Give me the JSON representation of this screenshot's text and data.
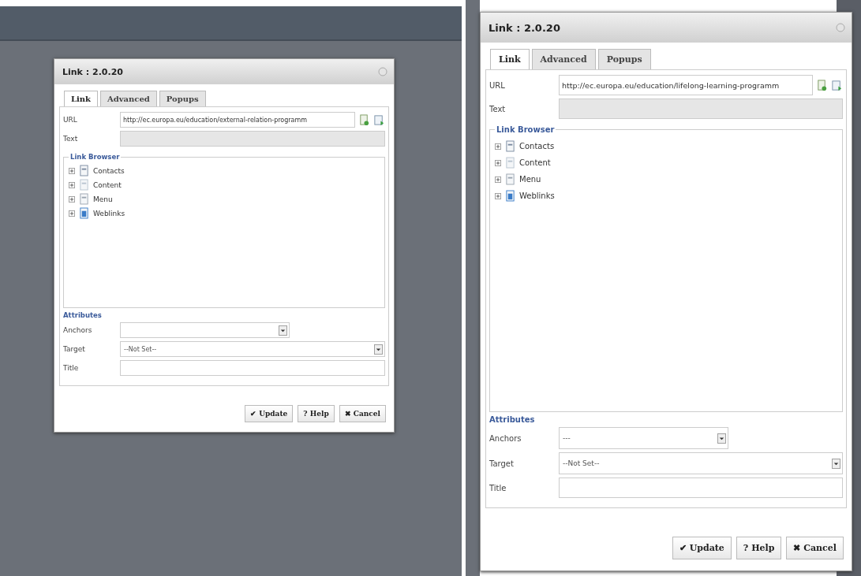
{
  "screenshots": [
    {
      "dialog": {
        "title": "Link : 2.0.20",
        "tabs": [
          {
            "label": "Link",
            "selected": true
          },
          {
            "label": "Advanced",
            "selected": false
          },
          {
            "label": "Popups",
            "selected": false
          }
        ],
        "url": {
          "label": "URL",
          "value": "http://ec.europa.eu/education/external-relation-programm"
        },
        "text": {
          "label": "Text",
          "disabled": true
        },
        "link_browser": {
          "legend": "Link Browser",
          "items": [
            {
              "label": "Contacts",
              "kind": "contacts",
              "expanded": false
            },
            {
              "label": "Content",
              "kind": "content",
              "expanded": false
            },
            {
              "label": "Menu",
              "kind": "menu",
              "expanded": false
            },
            {
              "label": "Weblinks",
              "kind": "weblinks",
              "expanded": false
            }
          ]
        },
        "attributes": {
          "legend": "Attributes",
          "anchors": {
            "label": "Anchors"
          },
          "target": {
            "label": "Target",
            "value": "--Not Set--"
          },
          "title": {
            "label": "Title"
          }
        },
        "buttons": [
          {
            "icon": "✔",
            "label": "Update"
          },
          {
            "icon": "?",
            "label": "Help"
          },
          {
            "icon": "✖",
            "label": "Cancel"
          }
        ]
      }
    },
    {
      "dialog": {
        "title": "Link : 2.0.20",
        "tabs": [
          {
            "label": "Link",
            "selected": true
          },
          {
            "label": "Advanced",
            "selected": false
          },
          {
            "label": "Popups",
            "selected": false
          }
        ],
        "url": {
          "label": "URL",
          "value": "http://ec.europa.eu/education/lifelong-learning-programm"
        },
        "text": {
          "label": "Text",
          "disabled": true
        },
        "link_browser": {
          "legend": "Link Browser",
          "items": [
            {
              "label": "Contacts",
              "kind": "contacts",
              "expanded": false
            },
            {
              "label": "Content",
              "kind": "content",
              "expanded": false
            },
            {
              "label": "Menu",
              "kind": "menu",
              "expanded": false
            },
            {
              "label": "Weblinks",
              "kind": "weblinks",
              "expanded": false
            }
          ]
        },
        "attributes": {
          "legend": "Attributes",
          "anchors": {
            "label": "Anchors",
            "value": "---"
          },
          "target": {
            "label": "Target",
            "value": "--Not Set--"
          },
          "title": {
            "label": "Title"
          }
        },
        "buttons": [
          {
            "icon": "✔",
            "label": "Update"
          },
          {
            "icon": "?",
            "label": "Help"
          },
          {
            "icon": "✖",
            "label": "Cancel"
          }
        ]
      }
    }
  ]
}
